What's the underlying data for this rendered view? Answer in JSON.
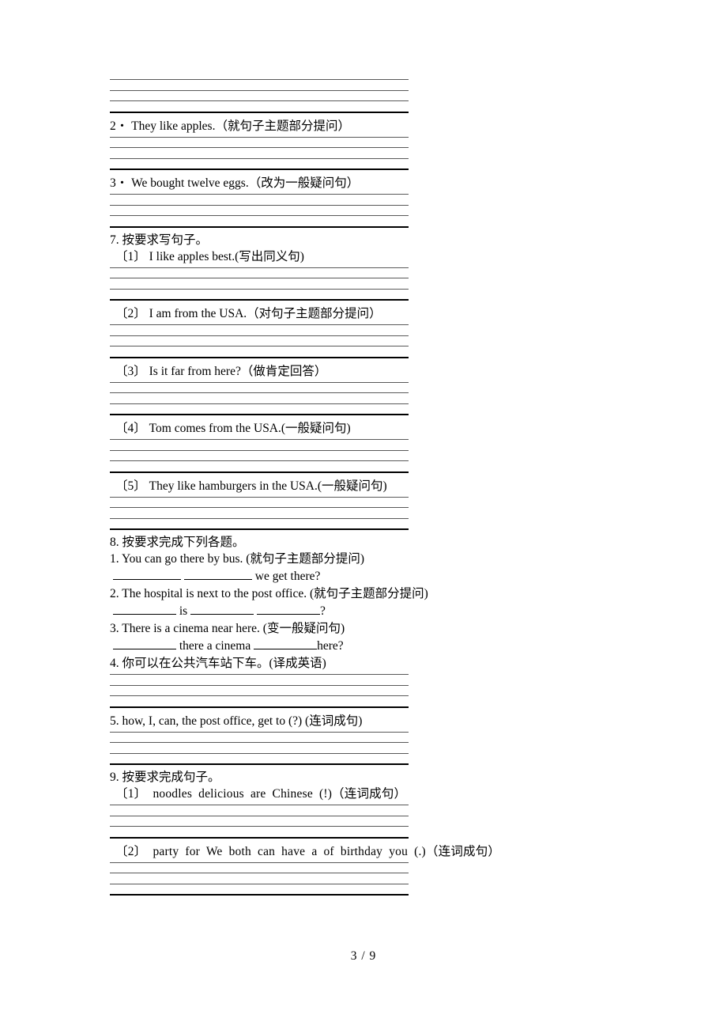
{
  "document": {
    "page_label": "3 / 9",
    "language": "zh-CN",
    "kind": "english-exercise-worksheet"
  },
  "top_continuation": {
    "note": "answer lines continuing from previous page"
  },
  "items_top": [
    {
      "number": "2・",
      "text": "They like apples.（就句子主题部分提问）"
    },
    {
      "number": "3・",
      "text": "We bought twelve eggs.（改为一般疑问句）"
    }
  ],
  "section7": {
    "heading": "7. 按要求写句子。",
    "items": [
      {
        "number": "〔1〕",
        "text": "I like apples best.(写出同义句)"
      },
      {
        "number": "〔2〕",
        "text": "I am from the USA.（对句子主题部分提问）"
      },
      {
        "number": "〔3〕",
        "text": "Is it far from here?（做肯定回答）"
      },
      {
        "number": "〔4〕",
        "text": "Tom comes from the USA.(一般疑问句)"
      },
      {
        "number": "〔5〕",
        "text": "They like hamburgers in the USA.(一般疑问句)"
      }
    ]
  },
  "section8": {
    "heading": "8. 按要求完成下列各题。",
    "items": [
      {
        "number": "1.",
        "text": "You can go there by bus. (就句子主题部分提问)",
        "answer_parts": [
          "",
          "",
          "we get there?"
        ],
        "answer_type": "blanks"
      },
      {
        "number": "2.",
        "text": "The hospital is next to the post office. (就句子主题部分提问)",
        "answer_parts": [
          "",
          "is",
          "",
          "",
          "?"
        ],
        "answer_type": "blanks"
      },
      {
        "number": "3.",
        "text": "There is a cinema near here. (变一般疑问句)",
        "answer_parts": [
          "",
          "there a cinema",
          "",
          "here?"
        ],
        "answer_type": "blanks"
      },
      {
        "number": "4.",
        "text": "你可以在公共汽车站下车。(译成英语)",
        "answer_type": "lines"
      },
      {
        "number": "5.",
        "text": "how, I, can, the post office, get to (?) (连词成句)",
        "answer_type": "lines"
      }
    ]
  },
  "section9": {
    "heading": "9. 按要求完成句子。",
    "items": [
      {
        "number": "〔1〕",
        "text": "noodles  delicious  are  Chinese (!)（连词成句）"
      },
      {
        "number": "〔2〕",
        "text": "party  for  We  both  can  have  a  of  birthday  you (.)（连词成句）"
      }
    ]
  },
  "answer_blanks": {
    "s8_1_a": "",
    "s8_1_b": "",
    "s8_1_tail": "we get there?",
    "s8_2_a": "",
    "s8_2_is": "is",
    "s8_2_b": "",
    "s8_2_c": "",
    "s8_2_q": "?",
    "s8_3_a": "",
    "s8_3_mid": "there a cinema",
    "s8_3_b": "",
    "s8_3_tail": "here?"
  }
}
